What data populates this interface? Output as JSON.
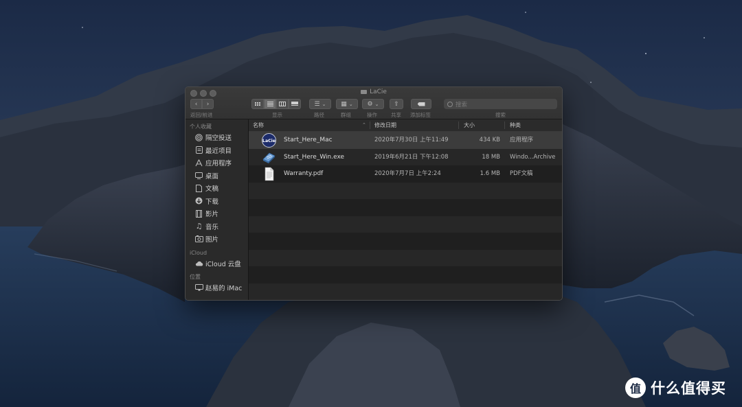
{
  "window": {
    "title": "LaCie",
    "toolbar": {
      "nav_label": "返回/前进",
      "view_label": "显示",
      "path_label": "路径",
      "group_label": "群组",
      "action_label": "操作",
      "share_label": "共享",
      "tag_label": "添加标签",
      "search_label": "搜索",
      "search_placeholder": "搜索"
    }
  },
  "sidebar": {
    "favorites_header": "个人收藏",
    "favorites": [
      {
        "label": "隔空投送",
        "icon": "airdrop-icon"
      },
      {
        "label": "最近项目",
        "icon": "recents-icon"
      },
      {
        "label": "应用程序",
        "icon": "applications-icon"
      },
      {
        "label": "桌面",
        "icon": "desktop-icon"
      },
      {
        "label": "文稿",
        "icon": "documents-icon"
      },
      {
        "label": "下载",
        "icon": "downloads-icon"
      },
      {
        "label": "影片",
        "icon": "movies-icon"
      },
      {
        "label": "音乐",
        "icon": "music-icon"
      },
      {
        "label": "图片",
        "icon": "pictures-icon"
      }
    ],
    "icloud_header": "iCloud",
    "icloud": [
      {
        "label": "iCloud 云盘",
        "icon": "cloud-icon"
      }
    ],
    "locations_header": "位置",
    "locations": [
      {
        "label": "赵易的 iMac",
        "icon": "imac-icon"
      }
    ]
  },
  "columns": {
    "name": "名称",
    "date": "修改日期",
    "size": "大小",
    "kind": "种类"
  },
  "files": [
    {
      "name": "Start_Here_Mac",
      "date": "2020年7月30日 上午11:49",
      "size": "434 KB",
      "kind": "应用程序",
      "icon": "lacie-app-icon",
      "selected": true
    },
    {
      "name": "Start_Here_Win.exe",
      "date": "2019年6月21日 下午12:08",
      "size": "18 MB",
      "kind": "Windo...Archive",
      "icon": "exe-archive-icon",
      "selected": false
    },
    {
      "name": "Warranty.pdf",
      "date": "2020年7月7日 上午2:24",
      "size": "1.6 MB",
      "kind": "PDF文稿",
      "icon": "pdf-document-icon",
      "selected": false
    }
  ],
  "watermark": {
    "text": "什么值得买",
    "logo_glyph": "值"
  }
}
